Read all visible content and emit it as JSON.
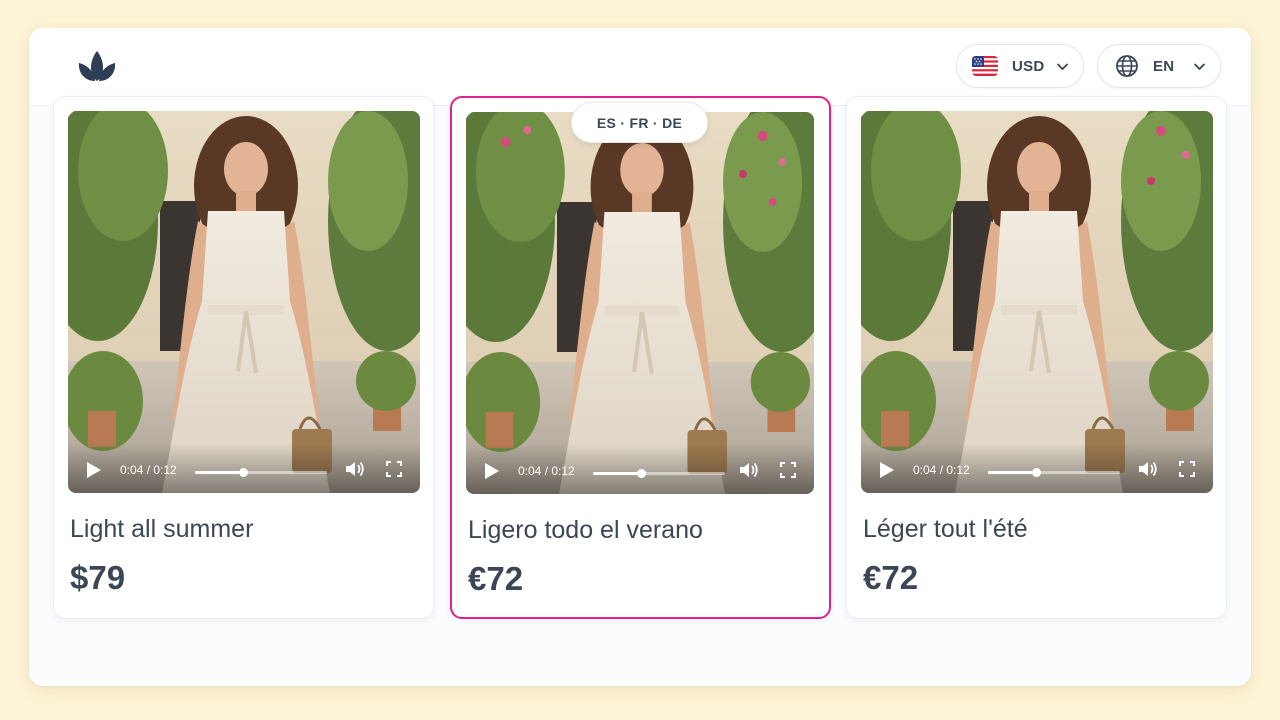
{
  "colors": {
    "page_bg": "#fdf3d6",
    "accent": "#e3208f",
    "text": "#3b4656"
  },
  "header": {
    "logo_icon": "leaf-logo-icon",
    "currency": {
      "flag_icon": "us-flag-icon",
      "label": "USD",
      "chevron_icon": "chevron-down-icon"
    },
    "language": {
      "globe_icon": "globe-icon",
      "label": "EN",
      "chevron_icon": "chevron-down-icon"
    }
  },
  "language_badge": "ES · FR · DE",
  "cards": [
    {
      "title": "Light all summer",
      "price": "$79",
      "time": "0:04 / 0:12",
      "progress": 0.36,
      "highlighted": false
    },
    {
      "title": "Ligero todo el verano",
      "price": "€72",
      "time": "0:04 / 0:12",
      "progress": 0.36,
      "highlighted": true
    },
    {
      "title": "Léger tout l'été",
      "price": "€72",
      "time": "0:04 / 0:12",
      "progress": 0.36,
      "highlighted": false
    }
  ]
}
